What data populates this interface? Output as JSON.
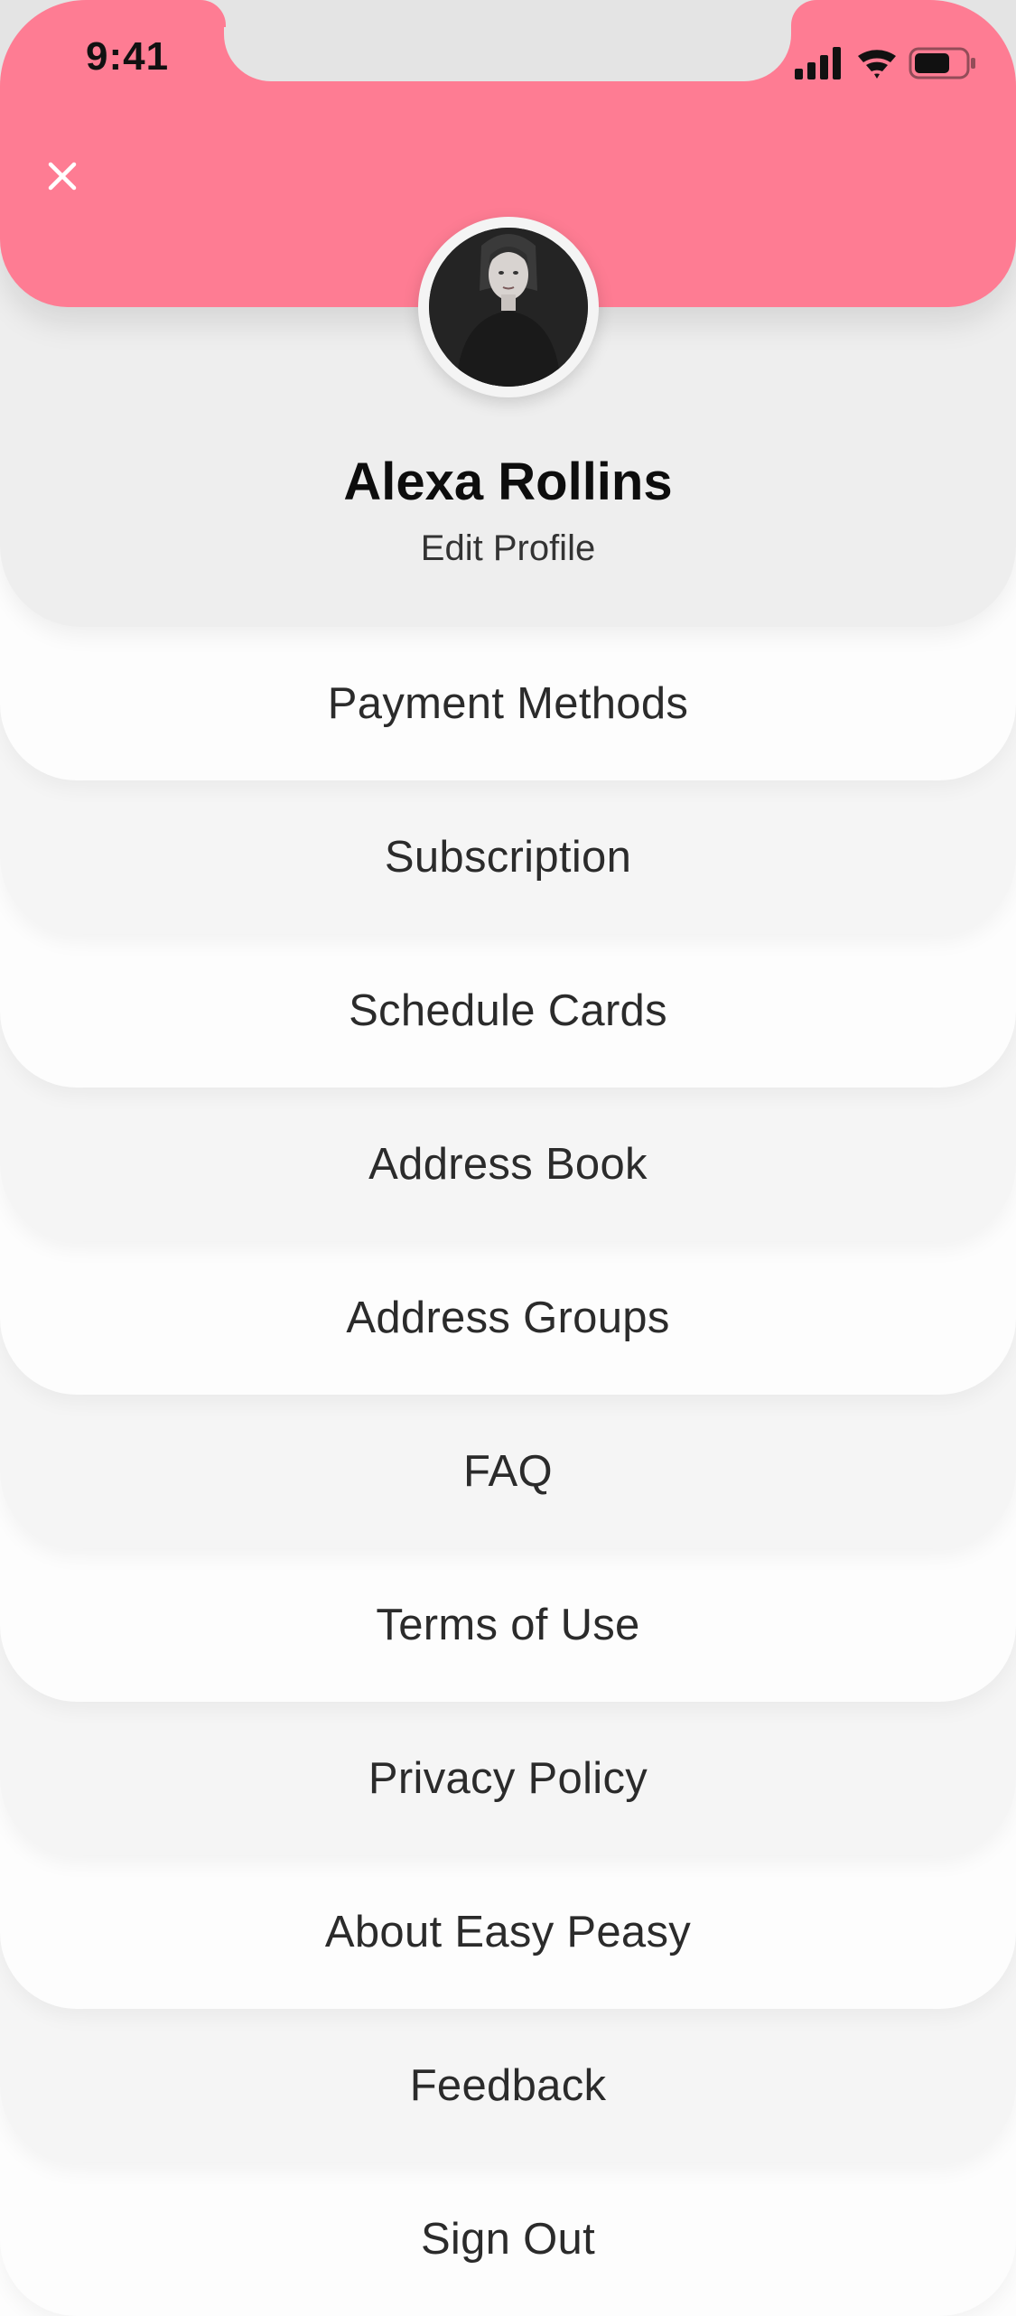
{
  "status_bar": {
    "time": "9:41"
  },
  "header": {
    "accent_color": "#fe7c93",
    "close_icon": "close-icon"
  },
  "profile": {
    "name": "Alexa Rollins",
    "edit_label": "Edit Profile",
    "avatar_icon": "avatar-photo"
  },
  "menu": {
    "items": [
      {
        "label": "Payment Methods"
      },
      {
        "label": "Subscription"
      },
      {
        "label": "Schedule Cards"
      },
      {
        "label": "Address Book"
      },
      {
        "label": "Address Groups"
      },
      {
        "label": "FAQ"
      },
      {
        "label": "Terms of Use"
      },
      {
        "label": "Privacy Policy"
      },
      {
        "label": "About Easy Peasy"
      },
      {
        "label": "Feedback"
      },
      {
        "label": "Sign Out"
      }
    ]
  }
}
